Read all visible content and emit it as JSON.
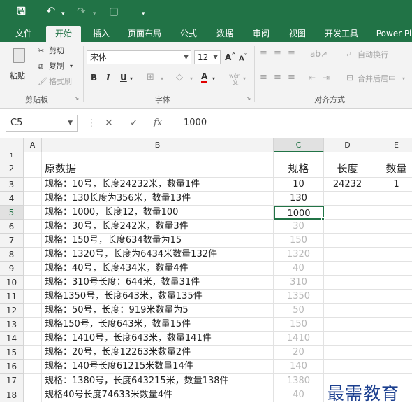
{
  "quick_access": {
    "save_icon": "save-icon",
    "undo_icon": "undo-icon",
    "redo_icon": "redo-icon",
    "print_preview_icon": "print-preview-icon",
    "customize_icon": "customize-qat-icon"
  },
  "tabs": [
    "文件",
    "开始",
    "插入",
    "页面布局",
    "公式",
    "数据",
    "审阅",
    "视图",
    "开发工具",
    "Power Pi"
  ],
  "active_tab": "开始",
  "ribbon": {
    "paste": "粘贴",
    "cut": "剪切",
    "copy": "复制",
    "format_painter": "格式刷",
    "clipboard_group": "剪贴板",
    "font_name": "宋体",
    "font_size": "12",
    "grow_font": "A",
    "shrink_font": "A",
    "bold": "B",
    "italic": "I",
    "underline": "U",
    "font_color_letter": "A",
    "phonetic": "wén",
    "font_group": "字体",
    "wrap_text": "自动换行",
    "merge_center": "合并后居中",
    "alignment_group": "对齐方式"
  },
  "formula_bar": {
    "name_box": "C5",
    "cancel": "✕",
    "confirm": "✓",
    "fx": "fx",
    "value": "1000"
  },
  "columns": [
    "A",
    "B",
    "C",
    "D",
    "E"
  ],
  "selected_column": "C",
  "rows": [
    {
      "num": "1",
      "b": "",
      "c": "",
      "d": "",
      "e": "",
      "c_flash": false
    },
    {
      "num": "2",
      "b": "原数据",
      "c": "规格",
      "d": "长度",
      "e": "数量",
      "c_flash": false
    },
    {
      "num": "3",
      "b": "规格：10号，长度24232米，数量1件",
      "c": "10",
      "d": "24232",
      "e": "1",
      "c_flash": false
    },
    {
      "num": "4",
      "b": "规格：130长度为356米，数量13件",
      "c": "130",
      "d": "",
      "e": "",
      "c_flash": false
    },
    {
      "num": "5",
      "b": "规格：1000，长度12，数量100",
      "c": "1000",
      "d": "",
      "e": "",
      "c_flash": false
    },
    {
      "num": "6",
      "b": "规格：30号，长度242米，数量3件",
      "c": "30",
      "d": "",
      "e": "",
      "c_flash": true
    },
    {
      "num": "7",
      "b": "规格：150号，长度634数量为15",
      "c": "150",
      "d": "",
      "e": "",
      "c_flash": true
    },
    {
      "num": "8",
      "b": "规格：1320号，长度为6434米数量132件",
      "c": "1320",
      "d": "",
      "e": "",
      "c_flash": true
    },
    {
      "num": "9",
      "b": "规格：40号，长度434米，数量4件",
      "c": "40",
      "d": "",
      "e": "",
      "c_flash": true
    },
    {
      "num": "10",
      "b": "规格：310号长度：644米，数量31件",
      "c": "310",
      "d": "",
      "e": "",
      "c_flash": true
    },
    {
      "num": "11",
      "b": "规格1350号，长度643米，数量135件",
      "c": "1350",
      "d": "",
      "e": "",
      "c_flash": true
    },
    {
      "num": "12",
      "b": "规格：50号，长度：919米数量为5",
      "c": "50",
      "d": "",
      "e": "",
      "c_flash": true
    },
    {
      "num": "13",
      "b": "规格150号，长度643米，数量15件",
      "c": "150",
      "d": "",
      "e": "",
      "c_flash": true
    },
    {
      "num": "14",
      "b": "规格：1410号，长度643米，数量141件",
      "c": "1410",
      "d": "",
      "e": "",
      "c_flash": true
    },
    {
      "num": "15",
      "b": "规格：20号，长度12263米数量2件",
      "c": "20",
      "d": "",
      "e": "",
      "c_flash": true
    },
    {
      "num": "16",
      "b": "规格：140号长度61215米数量14件",
      "c": "140",
      "d": "",
      "e": "",
      "c_flash": true
    },
    {
      "num": "17",
      "b": "规格：1380号，长度643215米，数量138件",
      "c": "1380",
      "d": "",
      "e": "",
      "c_flash": true
    },
    {
      "num": "18",
      "b": "规格40号长度74633米数量4件",
      "c": "40",
      "d": "",
      "e": "",
      "c_flash": true
    }
  ],
  "active_cell": {
    "row": "5",
    "col": "C"
  },
  "watermark": "最需教育",
  "colors": {
    "accent": "#217346",
    "flash_fill_preview": "#b8b8b8",
    "watermark": "#1b3f8f"
  }
}
